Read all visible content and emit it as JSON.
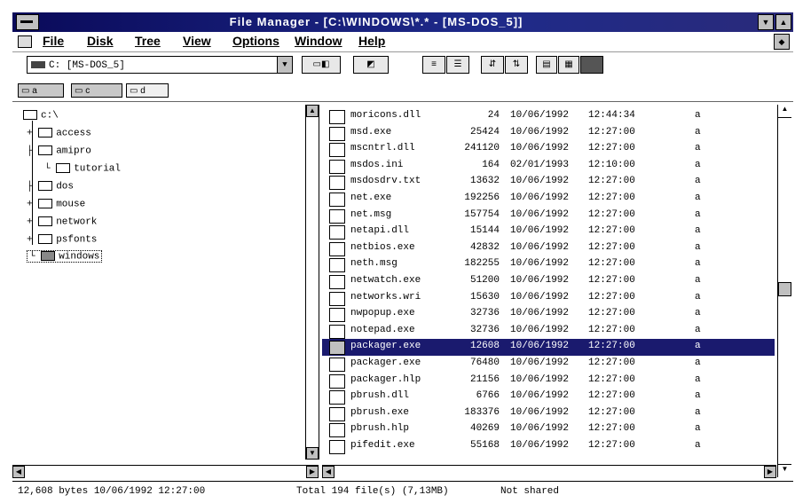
{
  "window": {
    "title": "File Manager - [C:\\WINDOWS\\*.* - [MS-DOS_5]]"
  },
  "menu": {
    "items": [
      "File",
      "Disk",
      "Tree",
      "View",
      "Options",
      "Window",
      "Help"
    ]
  },
  "toolbar": {
    "drive_label": "C: [MS-DOS_5]"
  },
  "drives": {
    "items": [
      "a",
      "c",
      "d"
    ]
  },
  "tree": {
    "items": [
      {
        "label": "c:\\"
      },
      {
        "label": "access"
      },
      {
        "label": "amipro"
      },
      {
        "label": "tutorial"
      },
      {
        "label": "dos"
      },
      {
        "label": "mouse"
      },
      {
        "label": "network"
      },
      {
        "label": "psfonts"
      },
      {
        "label": "windows"
      }
    ]
  },
  "files": {
    "rows": [
      {
        "name": "moricons.dll",
        "size": "24",
        "date": "10/06/1992",
        "time": "12:44:34",
        "attr": "a"
      },
      {
        "name": "msd.exe",
        "size": "25424",
        "date": "10/06/1992",
        "time": "12:27:00",
        "attr": "a"
      },
      {
        "name": "mscntrl.dll",
        "size": "241120",
        "date": "10/06/1992",
        "time": "12:27:00",
        "attr": "a"
      },
      {
        "name": "msdos.ini",
        "size": "164",
        "date": "02/01/1993",
        "time": "12:10:00",
        "attr": "a"
      },
      {
        "name": "msdosdrv.txt",
        "size": "13632",
        "date": "10/06/1992",
        "time": "12:27:00",
        "attr": "a"
      },
      {
        "name": "net.exe",
        "size": "192256",
        "date": "10/06/1992",
        "time": "12:27:00",
        "attr": "a"
      },
      {
        "name": "net.msg",
        "size": "157754",
        "date": "10/06/1992",
        "time": "12:27:00",
        "attr": "a"
      },
      {
        "name": "netapi.dll",
        "size": "15144",
        "date": "10/06/1992",
        "time": "12:27:00",
        "attr": "a"
      },
      {
        "name": "netbios.exe",
        "size": "42832",
        "date": "10/06/1992",
        "time": "12:27:00",
        "attr": "a"
      },
      {
        "name": "neth.msg",
        "size": "182255",
        "date": "10/06/1992",
        "time": "12:27:00",
        "attr": "a"
      },
      {
        "name": "netwatch.exe",
        "size": "51200",
        "date": "10/06/1992",
        "time": "12:27:00",
        "attr": "a"
      },
      {
        "name": "networks.wri",
        "size": "15630",
        "date": "10/06/1992",
        "time": "12:27:00",
        "attr": "a"
      },
      {
        "name": "nwpopup.exe",
        "size": "32736",
        "date": "10/06/1992",
        "time": "12:27:00",
        "attr": "a"
      },
      {
        "name": "notepad.exe",
        "size": "32736",
        "date": "10/06/1992",
        "time": "12:27:00",
        "attr": "a"
      },
      {
        "name": "packager.exe",
        "size": "12608",
        "date": "10/06/1992",
        "time": "12:27:00",
        "attr": "a",
        "selected": true
      },
      {
        "name": "packager.exe",
        "size": "76480",
        "date": "10/06/1992",
        "time": "12:27:00",
        "attr": "a"
      },
      {
        "name": "packager.hlp",
        "size": "21156",
        "date": "10/06/1992",
        "time": "12:27:00",
        "attr": "a"
      },
      {
        "name": "pbrush.dll",
        "size": "6766",
        "date": "10/06/1992",
        "time": "12:27:00",
        "attr": "a"
      },
      {
        "name": "pbrush.exe",
        "size": "183376",
        "date": "10/06/1992",
        "time": "12:27:00",
        "attr": "a"
      },
      {
        "name": "pbrush.hlp",
        "size": "40269",
        "date": "10/06/1992",
        "time": "12:27:00",
        "attr": "a"
      },
      {
        "name": "pifedit.exe",
        "size": "55168",
        "date": "10/06/1992",
        "time": "12:27:00",
        "attr": "a"
      }
    ]
  },
  "status": {
    "left": "12,608 bytes  10/06/1992 12:27:00",
    "middle": "Total 194 file(s) (7,13MB)",
    "right": "Not shared"
  },
  "colors": {
    "title_bar": "#1e2a8a",
    "selection": "#1a1a6e"
  }
}
